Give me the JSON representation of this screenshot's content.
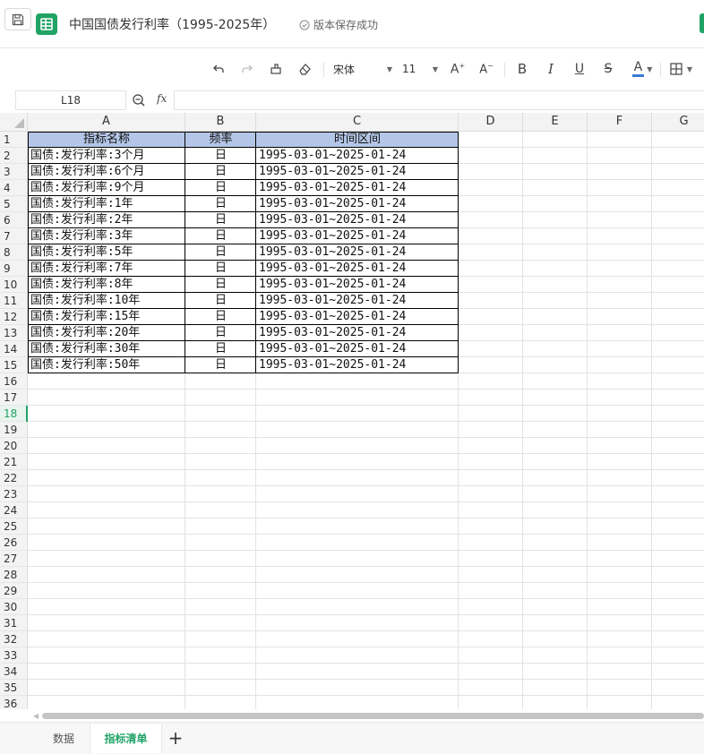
{
  "window": {
    "title": "中国国债发行利率（1995-2025年）",
    "save_status": "版本保存成功"
  },
  "toolbar": {
    "font_name": "宋体",
    "font_size": "11",
    "bold_label": "B",
    "italic_label": "I",
    "underline_label": "U",
    "strike_label": "S",
    "font_color_label": "A",
    "font_color": "#3a7bd5",
    "grow_label": "A",
    "shrink_label": "A"
  },
  "formula_bar": {
    "cell_ref": "L18",
    "fx_label": "fx",
    "formula": ""
  },
  "grid": {
    "columns": [
      "A",
      "B",
      "C",
      "D",
      "E",
      "F",
      "G"
    ],
    "rows": [
      "1",
      "2",
      "3",
      "4",
      "5",
      "6",
      "7",
      "8",
      "9",
      "10",
      "11",
      "12",
      "13",
      "14",
      "15",
      "16",
      "17",
      "18",
      "19",
      "20",
      "21",
      "22",
      "23",
      "24",
      "25",
      "26",
      "27",
      "28",
      "29",
      "30",
      "31",
      "32",
      "33",
      "34",
      "35",
      "36"
    ],
    "active_row": "18",
    "header_fill": "#b4c6e7",
    "headers": [
      "指标名称",
      "频率",
      "时间区间"
    ],
    "data": [
      [
        "国债:发行利率:3个月",
        "日",
        "1995-03-01~2025-01-24"
      ],
      [
        "国债:发行利率:6个月",
        "日",
        "1995-03-01~2025-01-24"
      ],
      [
        "国债:发行利率:9个月",
        "日",
        "1995-03-01~2025-01-24"
      ],
      [
        "国债:发行利率:1年",
        "日",
        "1995-03-01~2025-01-24"
      ],
      [
        "国债:发行利率:2年",
        "日",
        "1995-03-01~2025-01-24"
      ],
      [
        "国债:发行利率:3年",
        "日",
        "1995-03-01~2025-01-24"
      ],
      [
        "国债:发行利率:5年",
        "日",
        "1995-03-01~2025-01-24"
      ],
      [
        "国债:发行利率:7年",
        "日",
        "1995-03-01~2025-01-24"
      ],
      [
        "国债:发行利率:8年",
        "日",
        "1995-03-01~2025-01-24"
      ],
      [
        "国债:发行利率:10年",
        "日",
        "1995-03-01~2025-01-24"
      ],
      [
        "国债:发行利率:15年",
        "日",
        "1995-03-01~2025-01-24"
      ],
      [
        "国债:发行利率:20年",
        "日",
        "1995-03-01~2025-01-24"
      ],
      [
        "国债:发行利率:30年",
        "日",
        "1995-03-01~2025-01-24"
      ],
      [
        "国债:发行利率:50年",
        "日",
        "1995-03-01~2025-01-24"
      ]
    ]
  },
  "sheets": {
    "tabs": [
      "数据",
      "指标清单"
    ],
    "active": "指标清单",
    "add_label": "+"
  },
  "accent_color": "#21a366"
}
